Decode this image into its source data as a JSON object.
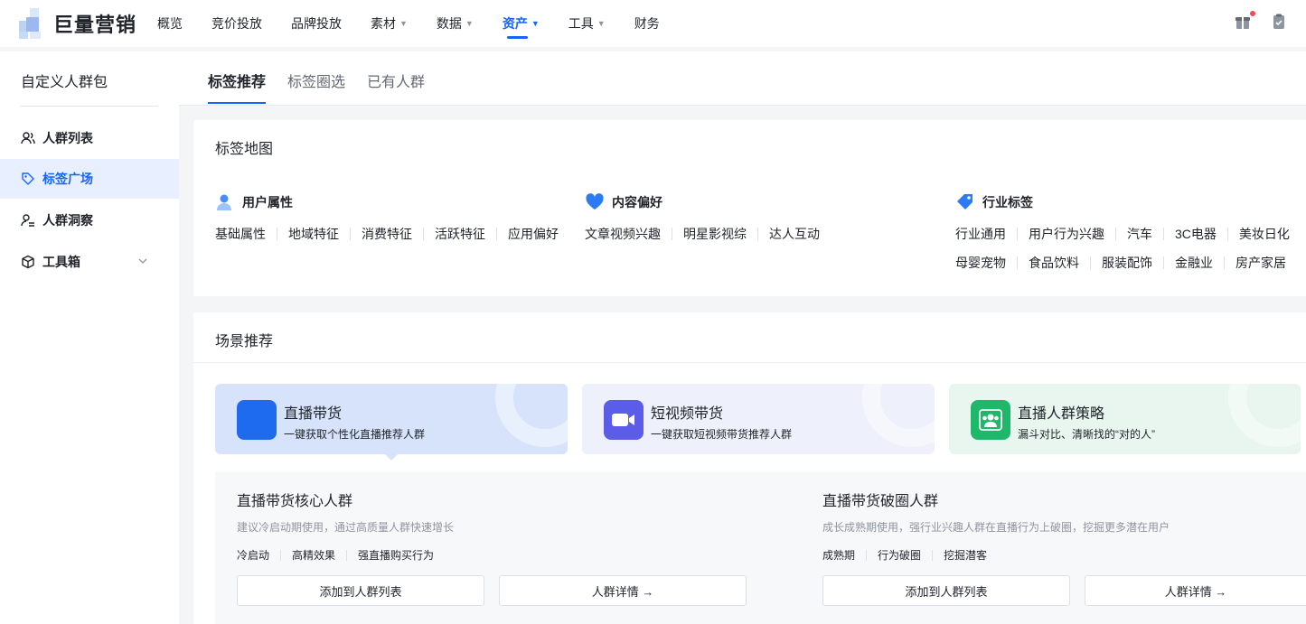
{
  "brand": {
    "name": "巨量营销"
  },
  "nav": {
    "items": [
      {
        "label": "概览",
        "caret": false,
        "active": false
      },
      {
        "label": "竞价投放",
        "caret": false,
        "active": false
      },
      {
        "label": "品牌投放",
        "caret": false,
        "active": false
      },
      {
        "label": "素材",
        "caret": true,
        "active": false
      },
      {
        "label": "数据",
        "caret": true,
        "active": false
      },
      {
        "label": "资产",
        "caret": true,
        "active": true
      },
      {
        "label": "工具",
        "caret": true,
        "active": false
      },
      {
        "label": "财务",
        "caret": false,
        "active": false
      }
    ],
    "caret_glyph": "▼",
    "icons": [
      "gift-icon",
      "clipboard-icon"
    ]
  },
  "sidebar": {
    "title": "自定义人群包",
    "items": [
      {
        "label": "人群列表",
        "icon": "users-icon",
        "active": false
      },
      {
        "label": "标签广场",
        "icon": "tag-icon",
        "active": true
      },
      {
        "label": "人群洞察",
        "icon": "user-search-icon",
        "active": false
      },
      {
        "label": "工具箱",
        "icon": "box-icon",
        "active": false,
        "expandable": true
      }
    ]
  },
  "tabs": [
    {
      "label": "标签推荐",
      "active": true
    },
    {
      "label": "标签圈选",
      "active": false
    },
    {
      "label": "已有人群",
      "active": false
    }
  ],
  "tag_map": {
    "title": "标签地图",
    "groups": [
      {
        "title": "用户属性",
        "icon": "user-attr-icon",
        "rows": [
          [
            "基础属性",
            "地域特征",
            "消费特征",
            "活跃特征",
            "应用偏好"
          ]
        ]
      },
      {
        "title": "内容偏好",
        "icon": "heart-icon",
        "rows": [
          [
            "文章视频兴趣",
            "明星影视综",
            "达人互动"
          ]
        ]
      },
      {
        "title": "行业标签",
        "icon": "industry-tag-icon",
        "rows": [
          [
            "行业通用",
            "用户行为兴趣",
            "汽车",
            "3C电器",
            "美妆日化"
          ],
          [
            "母婴宠物",
            "食品饮料",
            "服装配饰",
            "金融业",
            "房产家居"
          ]
        ]
      }
    ]
  },
  "scenes": {
    "title": "场景推荐",
    "cards": [
      {
        "name": "直播带货",
        "desc": "一键获取个性化直播推荐人群",
        "icon": "live-icon",
        "bg": "#d6e3fb",
        "icon_bg": "#1f6bf0",
        "selected": true
      },
      {
        "name": "短视频带货",
        "desc": "一键获取短视频带货推荐人群",
        "icon": "video-camera-icon",
        "bg": "#eef0fb",
        "icon_bg": "#5b5ce8",
        "selected": false
      },
      {
        "name": "直播人群策略",
        "desc": "漏斗对比、清晰找的“对的人”",
        "icon": "group-icon",
        "bg": "#e8f6ef",
        "icon_bg": "#1fb86a",
        "selected": false
      }
    ]
  },
  "audiences": [
    {
      "title": "直播带货核心人群",
      "desc": "建议冷启动期使用，通过高质量人群快速增长",
      "tags": [
        "冷启动",
        "高精效果",
        "强直播购买行为"
      ],
      "add_label": "添加到人群列表",
      "detail_label": "人群详情 →"
    },
    {
      "title": "直播带货破圈人群",
      "desc": "成长成熟期使用，强行业兴趣人群在直播行为上破圈，挖掘更多潜在用户",
      "tags": [
        "成熟期",
        "行为破圈",
        "挖掘潜客"
      ],
      "add_label": "添加到人群列表",
      "detail_label": "人群详情 →"
    }
  ],
  "colors": {
    "accent": "#1664ff",
    "text": "#1f2329",
    "muted": "#8f959e",
    "sidebar_active_bg": "#e8f0ff"
  }
}
